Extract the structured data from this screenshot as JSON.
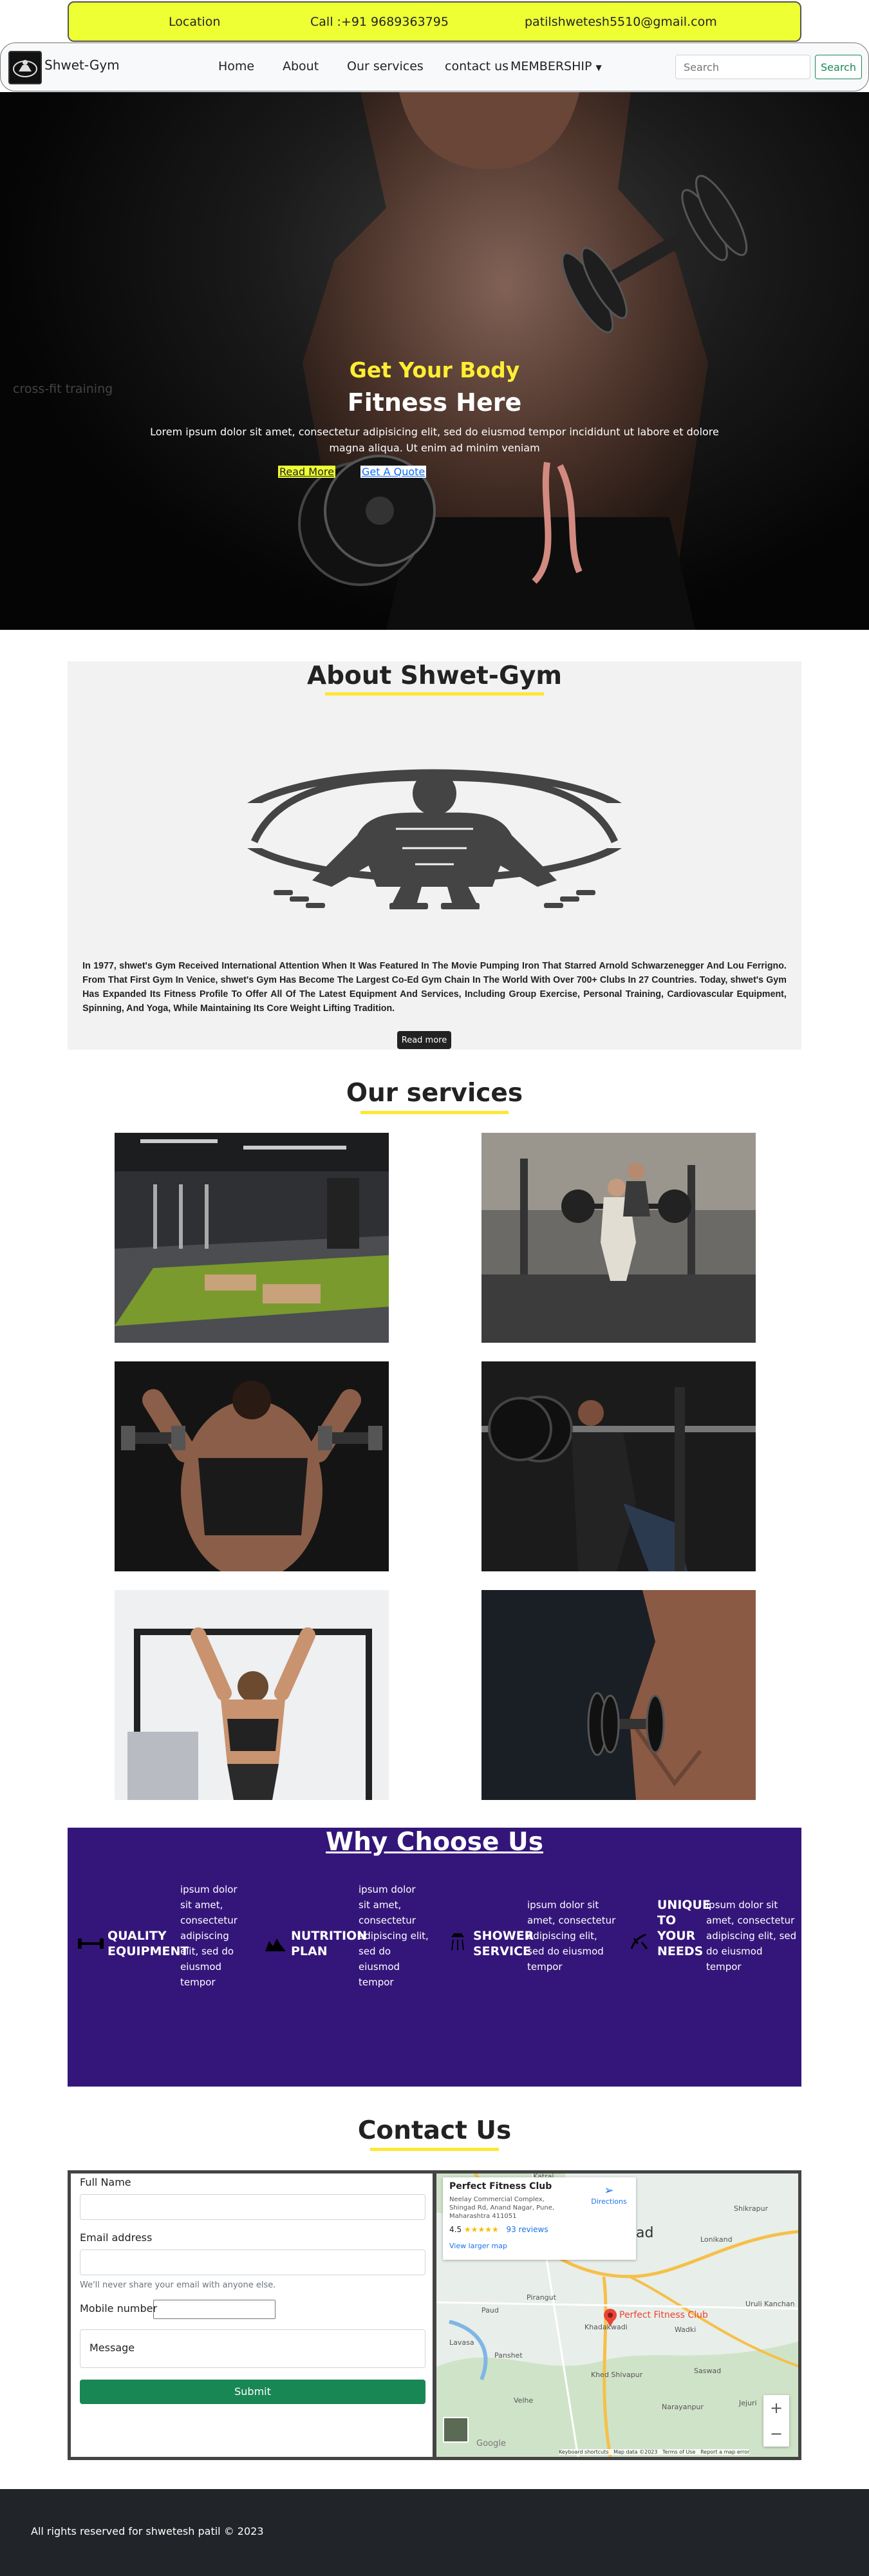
{
  "topbar": {
    "location": "Location",
    "call": "Call :+91 9689363795",
    "email": "patilshwetesh5510@gmail.com"
  },
  "navbar": {
    "brand": "Shwet-Gym",
    "links": [
      "Home",
      "About",
      "Our services",
      "contact us",
      "MEMBERSHIP"
    ],
    "search_placeholder": "Search",
    "search_button": "Search"
  },
  "hero": {
    "side_label": "cross-fit training",
    "title_line1": "Get Your Body",
    "title_line2": "Fitness Here",
    "text": "Lorem ipsum dolor sit amet, consectetur adipisicing elit, sed do eiusmod tempor incididunt ut labore et dolore magna aliqua. Ut enim ad minim veniam",
    "btn_read": "Read More",
    "btn_quote": "Get A Quote"
  },
  "about": {
    "title": "About Shwet-Gym",
    "text": "In 1977, shwet's Gym Received International Attention When It Was Featured In The Movie Pumping Iron That Starred Arnold Schwarzenegger And Lou Ferrigno. From That First Gym In Venice, shwet's Gym Has Become The Largest Co-Ed Gym Chain In The World With Over 700+ Clubs In 27 Countries. Today, shwet's Gym Has Expanded Its Fitness Profile To Offer All Of The Latest Equipment And Services, Including Group Exercise, Personal Training, Cardiovascular Equipment, Spinning, And Yoga, While Maintaining Its Core Weight Lifting Tradition.",
    "button": "Read more"
  },
  "services": {
    "title": "Our services"
  },
  "why": {
    "title": "Why Choose Us",
    "items": [
      {
        "title1": "QUALITY",
        "title2": "EQUIPMENT",
        "text": [
          "ipsum dolor",
          "sit amet,",
          "consectetur",
          "adipiscing",
          "elit, sed do",
          "eiusmod",
          "tempor"
        ]
      },
      {
        "title1": "NUTRITION",
        "title2": "PLAN",
        "text": [
          "ipsum dolor",
          "sit amet,",
          "consectetur",
          "adipiscing elit,",
          "sed do",
          "eiusmod",
          "tempor"
        ]
      },
      {
        "title1": "SHOWER",
        "title2": "SERVICE",
        "text": [
          "ipsum dolor sit",
          "amet, consectetur",
          "adipiscing elit,",
          "sed do eiusmod",
          "tempor"
        ]
      },
      {
        "title1": "UNIQUE",
        "title2": "TO",
        "title3": "YOUR",
        "title4": "NEEDS",
        "text": [
          "ipsum dolor sit",
          "amet, consectetur",
          "adipiscing elit, sed",
          "do eiusmod",
          "tempor"
        ]
      }
    ]
  },
  "contact": {
    "title": "Contact Us",
    "full_name_label": "Full Name",
    "email_label": "Email address",
    "email_help": "We'll never share your email with anyone else.",
    "mobile_label": "Mobile number",
    "message_placeholder": "Message",
    "submit": "Submit"
  },
  "map": {
    "place_name": "Perfect Fitness Club",
    "address": [
      "Neelay Commercial Complex,",
      "Shingad Rd, Anand Nagar, Pune,",
      "Maharashtra 411051"
    ],
    "rating": "4.5",
    "stars": "★★★★★",
    "reviews": "93 reviews",
    "larger_map": "View larger map",
    "directions": "Directions",
    "pin_label": "Perfect Fitness Club",
    "places": [
      "Katraj",
      "Shikrapur",
      "Lonikand",
      "Uruli Kanchan",
      "Wadki",
      "Saswad",
      "Jejuri",
      "Narayanpur",
      "Khadakwadi",
      "Pirangut",
      "Paud",
      "Lavasa",
      "Panshet",
      "Velhe",
      "Khed Shivapur",
      "ad"
    ],
    "footer": [
      "Keyboard shortcuts",
      "Map data ©2023",
      "Terms of Use",
      "Report a map error"
    ],
    "google": "Google"
  },
  "footer": {
    "text": "All rights reserved for shwetesh patil © 2023"
  },
  "colors": {
    "accent_yellow": "#eeff33",
    "why_bg": "#34167a",
    "submit_green": "#198754",
    "footer_bg": "#212529"
  }
}
